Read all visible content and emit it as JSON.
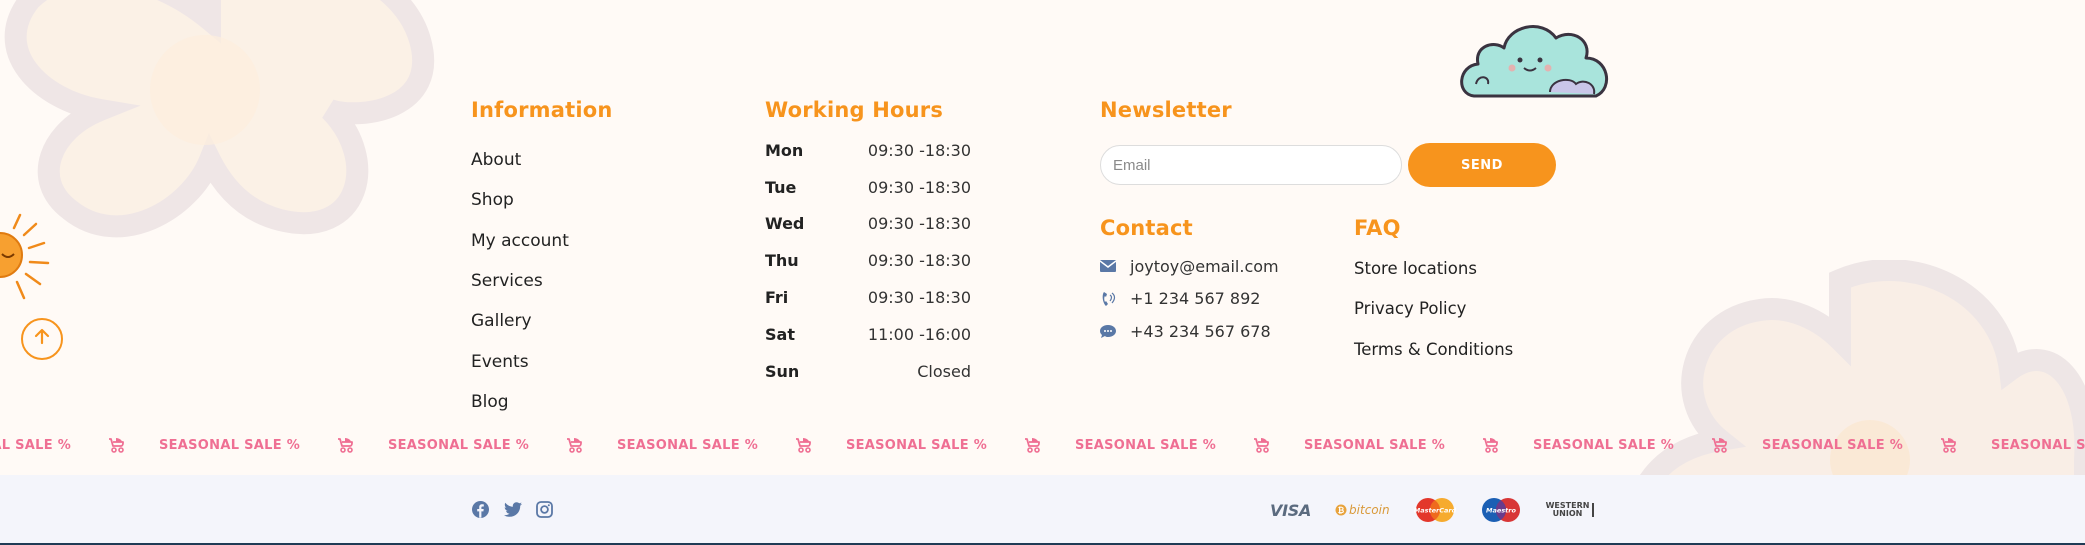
{
  "information": {
    "title": "Information",
    "links": [
      "About",
      "Shop",
      "My account",
      "Services",
      "Gallery",
      "Events",
      "Blog"
    ]
  },
  "working_hours": {
    "title": "Working Hours",
    "rows": [
      {
        "day": "Mon",
        "time": "09:30 -18:30"
      },
      {
        "day": "Tue",
        "time": "09:30 -18:30"
      },
      {
        "day": "Wed",
        "time": "09:30 -18:30"
      },
      {
        "day": "Thu",
        "time": "09:30 -18:30"
      },
      {
        "day": "Fri",
        "time": "09:30 -18:30"
      },
      {
        "day": "Sat",
        "time": "11:00 -16:00"
      },
      {
        "day": "Sun",
        "time": "Closed"
      }
    ]
  },
  "newsletter": {
    "title": "Newsletter",
    "email_placeholder": "Email",
    "send_label": "SEND"
  },
  "contact": {
    "title": "Contact",
    "email": "joytoy@email.com",
    "phone": "+1 234 567 892",
    "chat": "+43 234 567 678"
  },
  "faq": {
    "title": "FAQ",
    "links": [
      "Store locations",
      "Privacy Policy",
      "Terms & Conditions"
    ]
  },
  "marquee": {
    "text": "SEASONAL SALE %",
    "partial_text": "LE %"
  },
  "social_icons": [
    "facebook-icon",
    "twitter-icon",
    "instagram-icon"
  ],
  "payments": {
    "visa": "VISA",
    "bitcoin": "bitcoin",
    "mastercard": "MasterCard",
    "maestro": "Maestro",
    "western_union_1": "WESTERN",
    "western_union_2": "UNION"
  },
  "colors": {
    "accent": "#f7941d",
    "sale_pink": "#ef6f93",
    "background": "#fffaf6",
    "bottom_bar": "#f4f5fb"
  }
}
